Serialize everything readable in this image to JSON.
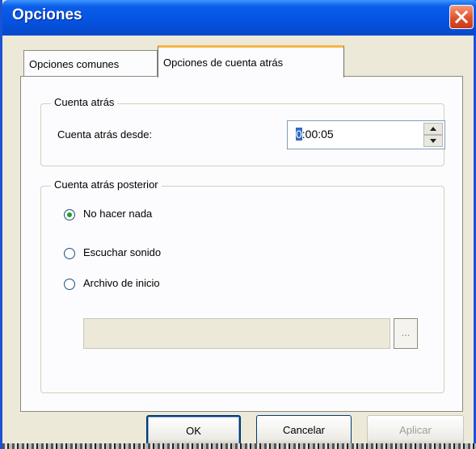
{
  "window": {
    "title": "Opciones"
  },
  "tabs": [
    {
      "label": "Opciones comunes",
      "active": false
    },
    {
      "label": "Opciones de cuenta atrás",
      "active": true
    }
  ],
  "countdown_group": {
    "legend": "Cuenta atrás",
    "field_label": "Cuenta atrás desde:",
    "value_first_digit": "0",
    "value_rest": ":00:05"
  },
  "after_group": {
    "legend": "Cuenta atrás posterior",
    "options": [
      {
        "label": "No hacer nada",
        "checked": true
      },
      {
        "label": "Escuchar sonido",
        "checked": false
      },
      {
        "label": "Archivo de inicio",
        "checked": false
      }
    ],
    "file_path_value": "",
    "browse_label": "..."
  },
  "buttons": {
    "ok": "OK",
    "cancel": "Cancelar",
    "apply": "Aplicar"
  },
  "colors": {
    "titlebar": "#0554e3",
    "dialog_bg": "#ece9d8",
    "tab_highlight": "#f7b44a",
    "close_button": "#e0512a"
  },
  "icons": {
    "close": "close-icon",
    "spin_up": "spin-up-icon",
    "spin_down": "spin-down-icon"
  }
}
